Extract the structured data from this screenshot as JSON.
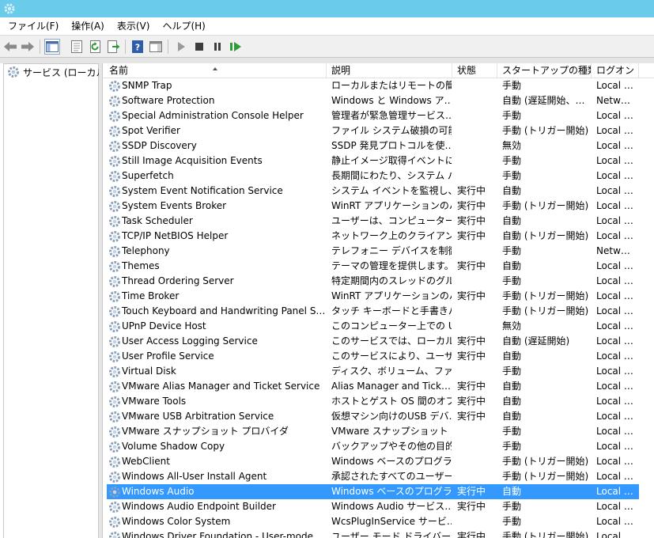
{
  "menu": [
    "ファイル(F)",
    "操作(A)",
    "表示(V)",
    "ヘルプ(H)"
  ],
  "toolbar": {
    "buttons": [
      "back-icon",
      "forward-icon",
      "show-hide-console-tree-icon",
      "properties-icon",
      "refresh-icon",
      "export-list-icon",
      "help-icon",
      "show-action-pane-icon",
      "start-service-icon",
      "stop-service-icon",
      "pause-service-icon",
      "restart-service-icon"
    ]
  },
  "tree": {
    "label": "サービス (ローカル)"
  },
  "columns": {
    "name": "名前",
    "desc": "説明",
    "status": "状態",
    "startup": "スタートアップの種類",
    "logon": "ログオン"
  },
  "colors": {
    "selection": "#3399ff",
    "titlebar": "#6bcbeb"
  },
  "services": [
    {
      "name": "SNMP Trap",
      "desc": "ローカルまたはリモートの簡易…",
      "status": "",
      "startup": "手動",
      "logon": "Local …"
    },
    {
      "name": "Software Protection",
      "desc": "Windows と Windows ア…",
      "status": "",
      "startup": "自動 (遅延開始、…",
      "logon": "Netw…"
    },
    {
      "name": "Special Administration Console Helper",
      "desc": "管理者が緊急管理サービス…",
      "status": "",
      "startup": "手動",
      "logon": "Local …"
    },
    {
      "name": "Spot Verifier",
      "desc": "ファイル システム破損の可能…",
      "status": "",
      "startup": "手動 (トリガー開始)",
      "logon": "Local …"
    },
    {
      "name": "SSDP Discovery",
      "desc": "SSDP 発見プロトコルを使…",
      "status": "",
      "startup": "無効",
      "logon": "Local …"
    },
    {
      "name": "Still Image Acquisition Events",
      "desc": "静止イメージ取得イベントに…",
      "status": "",
      "startup": "手動",
      "logon": "Local …"
    },
    {
      "name": "Superfetch",
      "desc": "長期間にわたり、システム パ…",
      "status": "",
      "startup": "手動",
      "logon": "Local …"
    },
    {
      "name": "System Event Notification Service",
      "desc": "システム イベントを監視し、…",
      "status": "実行中",
      "startup": "自動",
      "logon": "Local …"
    },
    {
      "name": "System Events Broker",
      "desc": "WinRT アプリケーションのバ…",
      "status": "実行中",
      "startup": "手動 (トリガー開始)",
      "logon": "Local …"
    },
    {
      "name": "Task Scheduler",
      "desc": "ユーザーは、コンピューターの…",
      "status": "実行中",
      "startup": "自動",
      "logon": "Local …"
    },
    {
      "name": "TCP/IP NetBIOS Helper",
      "desc": "ネットワーク上のクライアントに…",
      "status": "実行中",
      "startup": "自動 (トリガー開始)",
      "logon": "Local …"
    },
    {
      "name": "Telephony",
      "desc": "テレフォニー デバイスを制御…",
      "status": "",
      "startup": "手動",
      "logon": "Netw…"
    },
    {
      "name": "Themes",
      "desc": "テーマの管理を提供します。",
      "status": "実行中",
      "startup": "自動",
      "logon": "Local …"
    },
    {
      "name": "Thread Ordering Server",
      "desc": "特定期間内のスレッドのグル…",
      "status": "",
      "startup": "手動",
      "logon": "Local …"
    },
    {
      "name": "Time Broker",
      "desc": "WinRT アプリケーションのバ…",
      "status": "実行中",
      "startup": "手動 (トリガー開始)",
      "logon": "Local …"
    },
    {
      "name": "Touch Keyboard and Handwriting Panel S…",
      "desc": "タッチ キーボードと手書きパ…",
      "status": "",
      "startup": "手動 (トリガー開始)",
      "logon": "Local …"
    },
    {
      "name": "UPnP Device Host",
      "desc": "このコンピューター上での UP…",
      "status": "",
      "startup": "無効",
      "logon": "Local …"
    },
    {
      "name": "User Access Logging Service",
      "desc": "このサービスでは、ローカル サ…",
      "status": "実行中",
      "startup": "自動 (遅延開始)",
      "logon": "Local …"
    },
    {
      "name": "User Profile Service",
      "desc": "このサービスにより、ユーザー …",
      "status": "実行中",
      "startup": "自動",
      "logon": "Local …"
    },
    {
      "name": "Virtual Disk",
      "desc": "ディスク、ボリューム、ファイル …",
      "status": "",
      "startup": "手動",
      "logon": "Local …"
    },
    {
      "name": "VMware Alias Manager and Ticket Service",
      "desc": "Alias Manager and Tick…",
      "status": "実行中",
      "startup": "自動",
      "logon": "Local …"
    },
    {
      "name": "VMware Tools",
      "desc": "ホストとゲスト OS 間のオブ…",
      "status": "実行中",
      "startup": "自動",
      "logon": "Local …"
    },
    {
      "name": "VMware USB Arbitration Service",
      "desc": "仮想マシン向けのUSB デバ…",
      "status": "実行中",
      "startup": "自動",
      "logon": "Local …"
    },
    {
      "name": "VMware スナップショット プロバイダ",
      "desc": "VMware スナップショット プ…",
      "status": "",
      "startup": "手動",
      "logon": "Local …"
    },
    {
      "name": "Volume Shadow Copy",
      "desc": "バックアップやその他の目的で…",
      "status": "",
      "startup": "手動",
      "logon": "Local …"
    },
    {
      "name": "WebClient",
      "desc": "Windows ベースのプログラ…",
      "status": "",
      "startup": "手動 (トリガー開始)",
      "logon": "Local …"
    },
    {
      "name": "Windows All-User Install Agent",
      "desc": "承認されたすべてのユーザー…",
      "status": "",
      "startup": "手動 (トリガー開始)",
      "logon": "Local …"
    },
    {
      "name": "Windows Audio",
      "desc": "Windows ベースのプログラ…",
      "status": "実行中",
      "startup": "自動",
      "logon": "Local …",
      "selected": true
    },
    {
      "name": "Windows Audio Endpoint Builder",
      "desc": "Windows Audio サービス…",
      "status": "実行中",
      "startup": "手動",
      "logon": "Local …"
    },
    {
      "name": "Windows Color System",
      "desc": "WcsPlugInService サービ…",
      "status": "",
      "startup": "手動",
      "logon": "Local …"
    },
    {
      "name": "Windows Driver Foundation - User-mode …",
      "desc": "ユーザー モード ドライバー …",
      "status": "実行中",
      "startup": "手動 (トリガー開始)",
      "logon": "Local …"
    }
  ]
}
